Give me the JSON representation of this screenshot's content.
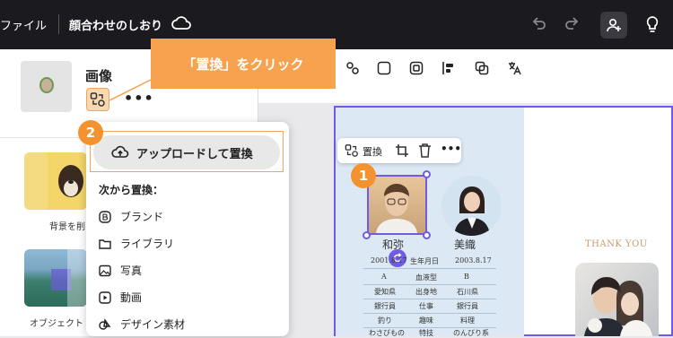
{
  "topbar": {
    "file_menu": "ファイル",
    "document_title": "顔合わせのしおり"
  },
  "panel": {
    "title": "画像",
    "gallery": [
      {
        "caption": "背景を削"
      },
      {
        "caption": "オブジェクト"
      }
    ]
  },
  "callout": {
    "text": "「置換」をクリック",
    "color": "#f7a24f"
  },
  "badges": {
    "step1": "1",
    "step2": "2"
  },
  "dropdown": {
    "upload_label": "アップロードして置換",
    "from_label": "次から置換：",
    "items": [
      {
        "label": "ブランド",
        "icon": "brand-icon"
      },
      {
        "label": "ライブラリ",
        "icon": "folder-icon"
      },
      {
        "label": "写真",
        "icon": "photo-icon"
      },
      {
        "label": "動画",
        "icon": "video-icon"
      },
      {
        "label": "デザイン素材",
        "icon": "elements-icon"
      }
    ]
  },
  "float_toolbar": {
    "replace_label": "置換"
  },
  "design": {
    "groom_name": "和弥",
    "bride_name": "美織",
    "rows": [
      {
        "left": "2001.8.17",
        "mid": "生年月日",
        "right": "2003.8.17"
      },
      {
        "left": "A",
        "mid": "血液型",
        "right": "B"
      },
      {
        "left": "愛知県",
        "mid": "出身地",
        "right": "石川県"
      },
      {
        "left": "銀行員",
        "mid": "仕事",
        "right": "銀行員"
      },
      {
        "left": "釣り",
        "mid": "趣味",
        "right": "料理"
      },
      {
        "left": "わさびもの",
        "mid": "特技",
        "right": "のんびり系"
      }
    ],
    "thank_you": "THANK YOU",
    "accent": "#6e5ce6"
  }
}
